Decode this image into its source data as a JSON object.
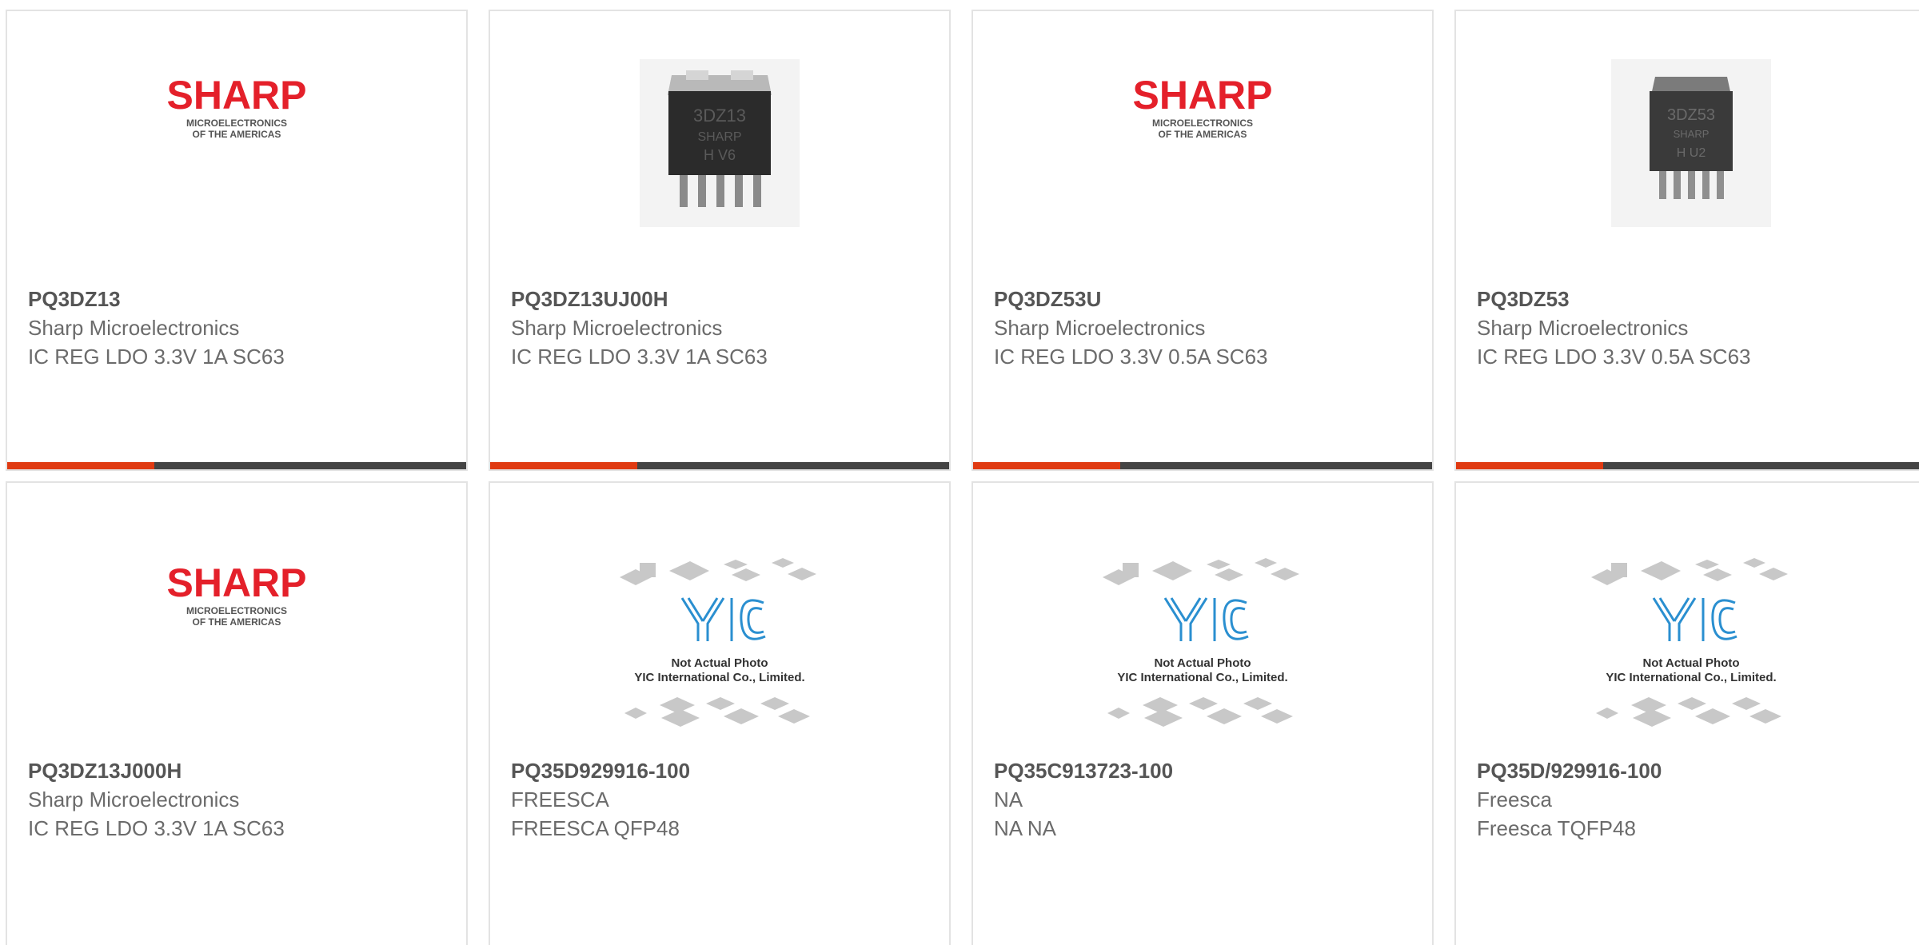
{
  "products": [
    {
      "part": "PQ3DZ13",
      "manufacturer": "Sharp Microelectronics",
      "description": "IC REG LDO 3.3V 1A SC63",
      "image": "sharp-logo",
      "logo_text": "SHARP",
      "logo_sub1": "MICROELECTRONICS",
      "logo_sub2": "OF THE AMERICAS"
    },
    {
      "part": "PQ3DZ13UJ00H",
      "manufacturer": "Sharp Microelectronics",
      "description": "IC REG LDO 3.3V 1A SC63",
      "image": "chip-photo",
      "chip_line1": "3DZ13",
      "chip_line2": "SHARP",
      "chip_line3": "H  V6"
    },
    {
      "part": "PQ3DZ53U",
      "manufacturer": "Sharp Microelectronics",
      "description": "IC REG LDO 3.3V 0.5A SC63",
      "image": "sharp-logo",
      "logo_text": "SHARP",
      "logo_sub1": "MICROELECTRONICS",
      "logo_sub2": "OF THE AMERICAS"
    },
    {
      "part": "PQ3DZ53",
      "manufacturer": "Sharp Microelectronics",
      "description": "IC REG LDO 3.3V 0.5A SC63",
      "image": "chip-photo",
      "chip_line1": "3DZ53",
      "chip_line2": "SHARP",
      "chip_line3": "H   U2"
    },
    {
      "part": "PQ3DZ13J000H",
      "manufacturer": "Sharp Microelectronics",
      "description": "IC REG LDO 3.3V 1A SC63",
      "image": "sharp-logo",
      "logo_text": "SHARP",
      "logo_sub1": "MICROELECTRONICS",
      "logo_sub2": "OF THE AMERICAS"
    },
    {
      "part": "PQ35D929916-100",
      "manufacturer": "FREESCA",
      "description": "FREESCA QFP48",
      "image": "placeholder",
      "placeholder_line1": "Not Actual Photo",
      "placeholder_line2": "YIC International Co., Limited."
    },
    {
      "part": "PQ35C913723-100",
      "manufacturer": "NA",
      "description": "NA NA",
      "image": "placeholder",
      "placeholder_line1": "Not Actual Photo",
      "placeholder_line2": "YIC International Co., Limited."
    },
    {
      "part": "PQ35D/929916-100",
      "manufacturer": "Freesca",
      "description": "Freesca TQFP48",
      "image": "placeholder",
      "placeholder_line1": "Not Actual Photo",
      "placeholder_line2": "YIC International Co., Limited."
    }
  ],
  "colors": {
    "sharp_red": "#e4202a",
    "accent": "#e03a12",
    "bar_dark": "#444444",
    "yic_blue": "#2a8fd0"
  }
}
